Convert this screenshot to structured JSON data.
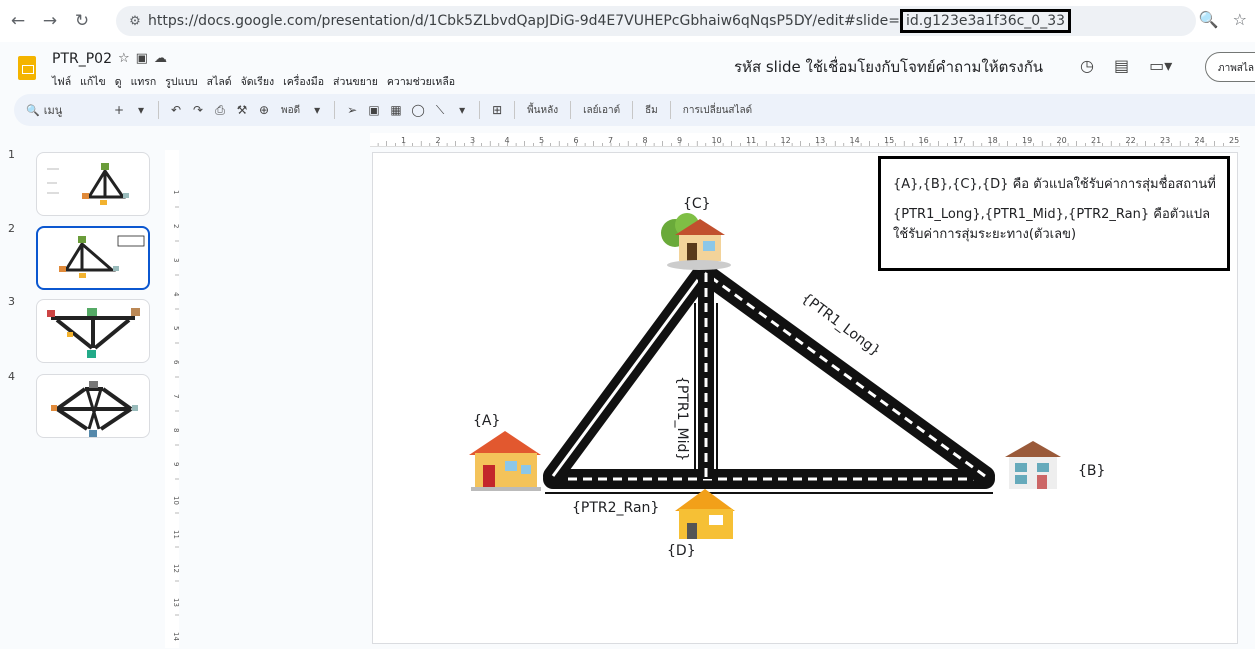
{
  "browser": {
    "url_main": "https://docs.google.com/presentation/d/1Cbk5ZLbvdQapJDiG-9d4E7VUHEPcGbhaiw6qNqsP5DY/edit#slide=",
    "url_highlight": "id.g123e3a1f36c_0_33"
  },
  "app": {
    "title": "PTR_P02",
    "menu": [
      "ไฟล์",
      "แก้ไข",
      "ดู",
      "แทรก",
      "รูปแบบ",
      "สไลด์",
      "จัดเรียง",
      "เครื่องมือ",
      "ส่วนขยาย",
      "ความช่วยเหลือ"
    ],
    "header_note": "รหัส slide ใช้เชื่อมโยงกับโจทย์คำถามให้ตรงกัน",
    "present_label": "ภาพสไล"
  },
  "toolbar": {
    "search": "เมนู",
    "zoom": "พอดี",
    "background": "พื้นหลัง",
    "layout": "เลย์เอาต์",
    "theme": "ธีม",
    "transition": "การเปลี่ยนสไลด์"
  },
  "ruler_numbers": [
    "1",
    "2",
    "3",
    "4",
    "5",
    "6",
    "7",
    "8",
    "9",
    "10",
    "11",
    "12",
    "13",
    "14",
    "15",
    "16",
    "17",
    "18",
    "19",
    "20",
    "21",
    "22",
    "23",
    "24",
    "25"
  ],
  "vruler_numbers": [
    "1",
    "2",
    "3",
    "4",
    "5",
    "6",
    "7",
    "8",
    "9",
    "10",
    "11",
    "12",
    "13",
    "14"
  ],
  "thumbnails": [
    {
      "num": "1"
    },
    {
      "num": "2"
    },
    {
      "num": "3"
    },
    {
      "num": "4"
    }
  ],
  "slide": {
    "info_line1": "{A},{B},{C},{D} คือ ตัวแปลใช้รับค่าการสุ่มชื่อสถานที่",
    "info_line2": "{PTR1_Long},{PTR1_Mid},{PTR2_Ran} คือตัวแปลใช้รับค่าการสุ่มระยะทาง(ตัวเลข)",
    "label_a": "{A}",
    "label_b": "{B}",
    "label_c": "{C}",
    "label_d": "{D}",
    "label_long": "{PTR1_Long}",
    "label_mid": "{PTR1_Mid}",
    "label_ran": "{PTR2_Ran}"
  }
}
